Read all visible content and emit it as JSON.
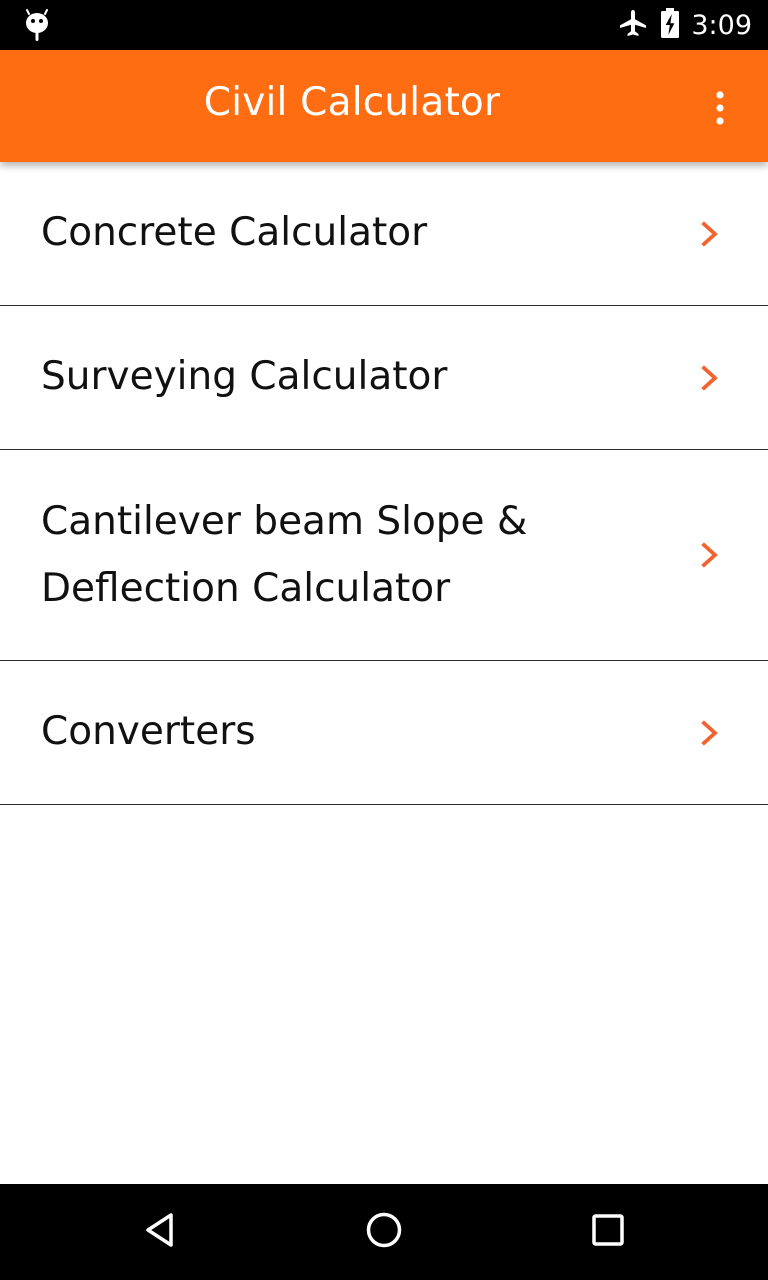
{
  "status_bar": {
    "time": "3:09",
    "left_icon": "android-debug-icon",
    "right_icons": [
      "airplane-mode-icon",
      "battery-charging-icon"
    ]
  },
  "app_bar": {
    "title": "Civil Calculator",
    "menu_icon": "more-vert-icon",
    "background_color": "#ff6d12"
  },
  "menu": {
    "items": [
      {
        "label": "Concrete Calculator",
        "icon": "chevron-right-icon"
      },
      {
        "label": "Surveying Calculator",
        "icon": "chevron-right-icon"
      },
      {
        "label": "Cantilever beam Slope & Deflection Calculator",
        "icon": "chevron-right-icon"
      },
      {
        "label": "Converters",
        "icon": "chevron-right-icon"
      }
    ],
    "chevron_color": "#f2632f"
  },
  "navigation_bar": {
    "buttons": [
      "back-icon",
      "home-icon",
      "recents-icon"
    ]
  }
}
